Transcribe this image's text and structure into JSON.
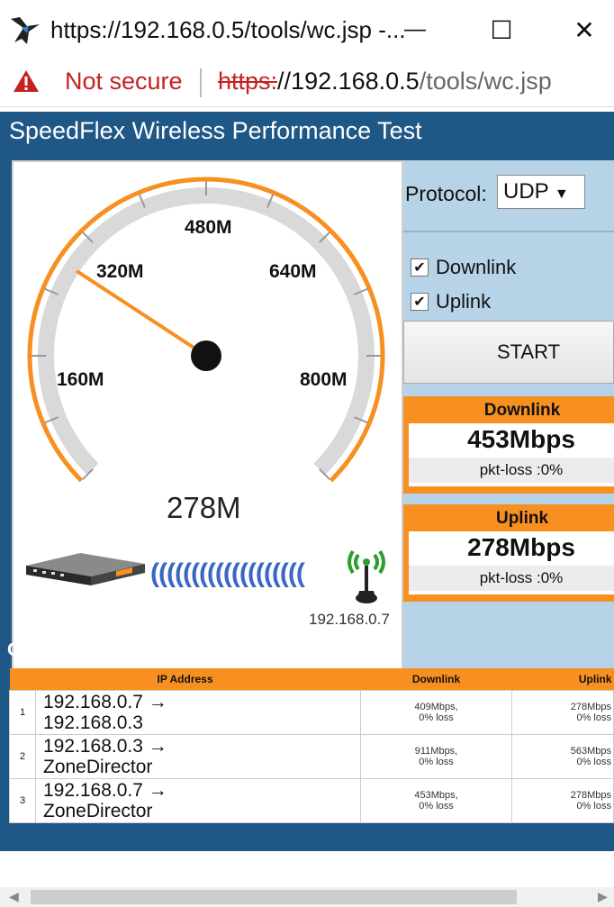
{
  "browser": {
    "window_title": "https://192.168.0.5/tools/wc.jsp -...",
    "security_label": "Not secure",
    "url_scheme": "https:",
    "url_host": "//192.168.0.5",
    "url_path": "/tools/wc.jsp",
    "minimize": "—",
    "maximize": "☐",
    "close": "✕"
  },
  "app": {
    "title": "SpeedFlex Wireless Performance Test",
    "gauge": {
      "tick_labels": [
        "160M",
        "320M",
        "480M",
        "640M",
        "800M"
      ],
      "current_value": "278M",
      "needle_value_mbps": 278,
      "max_mbps": 960,
      "client_ip": "192.168.0.7",
      "wave": "((((((((((((((((((("
    },
    "protocol": {
      "label": "Protocol:",
      "selected": "UDP",
      "arrow": "▼"
    },
    "checkboxes": [
      {
        "label": "Downlink",
        "checked": true
      },
      {
        "label": "Uplink",
        "checked": true
      }
    ],
    "start_label": "START",
    "downlink": {
      "title": "Downlink",
      "value": "453Mbps",
      "loss": "pkt-loss :0%"
    },
    "uplink": {
      "title": "Uplink",
      "value": "278Mbps",
      "loss": "pkt-loss :0%"
    },
    "status": "Complete!",
    "table": {
      "headers": [
        "IP Address",
        "Downlink",
        "Uplink"
      ],
      "rows": [
        {
          "index": "1",
          "ip_line1": "192.168.0.7 →",
          "ip_line2": "192.168.0.3",
          "down_rate": "409Mbps,",
          "down_loss": "0% loss",
          "up_rate": "278Mbps",
          "up_loss": "0% loss"
        },
        {
          "index": "2",
          "ip_line1": "192.168.0.3 →",
          "ip_line2": "ZoneDirector",
          "down_rate": "911Mbps,",
          "down_loss": "0% loss",
          "up_rate": "563Mbps",
          "up_loss": "0% loss"
        },
        {
          "index": "3",
          "ip_line1": "192.168.0.7 →",
          "ip_line2": "ZoneDirector",
          "down_rate": "453Mbps,",
          "down_loss": "0% loss",
          "up_rate": "278Mbps",
          "up_loss": "0% loss"
        }
      ]
    }
  },
  "colors": {
    "header_blue": "#1f5786",
    "accent_orange": "#f79020",
    "panel_blue": "#b7d3e8"
  },
  "icons": [
    "app-icon",
    "warning-icon",
    "minimize-icon",
    "maximize-icon",
    "close-icon",
    "check-icon",
    "router-icon",
    "antenna-icon",
    "scroll-left-icon",
    "scroll-right-icon"
  ]
}
